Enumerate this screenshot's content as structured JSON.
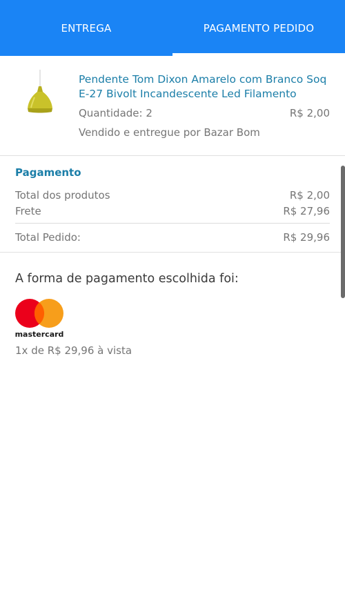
{
  "tabs": [
    {
      "label": "ENTREGA",
      "active": false
    },
    {
      "label": "PAGAMENTO PEDIDO",
      "active": true
    }
  ],
  "product": {
    "title": "Pendente Tom Dixon Amarelo com Branco Soq E-27 Bivolt Incandescente Led Filamento",
    "quantity": "Quantidade: 2",
    "price": "R$ 2,00",
    "seller": "Vendido e entregue por Bazar Bom"
  },
  "payment": {
    "heading": "Pagamento",
    "rows": [
      {
        "label": "Total dos produtos",
        "value": "R$ 2,00"
      },
      {
        "label": "Frete",
        "value": "R$ 27,96"
      },
      {
        "label": "Total Pedido:",
        "value": "R$ 29,96"
      }
    ]
  },
  "method": {
    "heading": "A forma de pagamento escolhida foi:",
    "brand": "mastercard",
    "installments": "1x de R$ 29,96 à vista"
  },
  "colors": {
    "primary": "#1a84f5",
    "link": "#1b7ea8",
    "mc_red": "#eb001b",
    "mc_orange": "#f79e1b"
  },
  "icons": {
    "product_image": "yellow-pendant-lamp",
    "payment_logo": "mastercard-logo"
  }
}
